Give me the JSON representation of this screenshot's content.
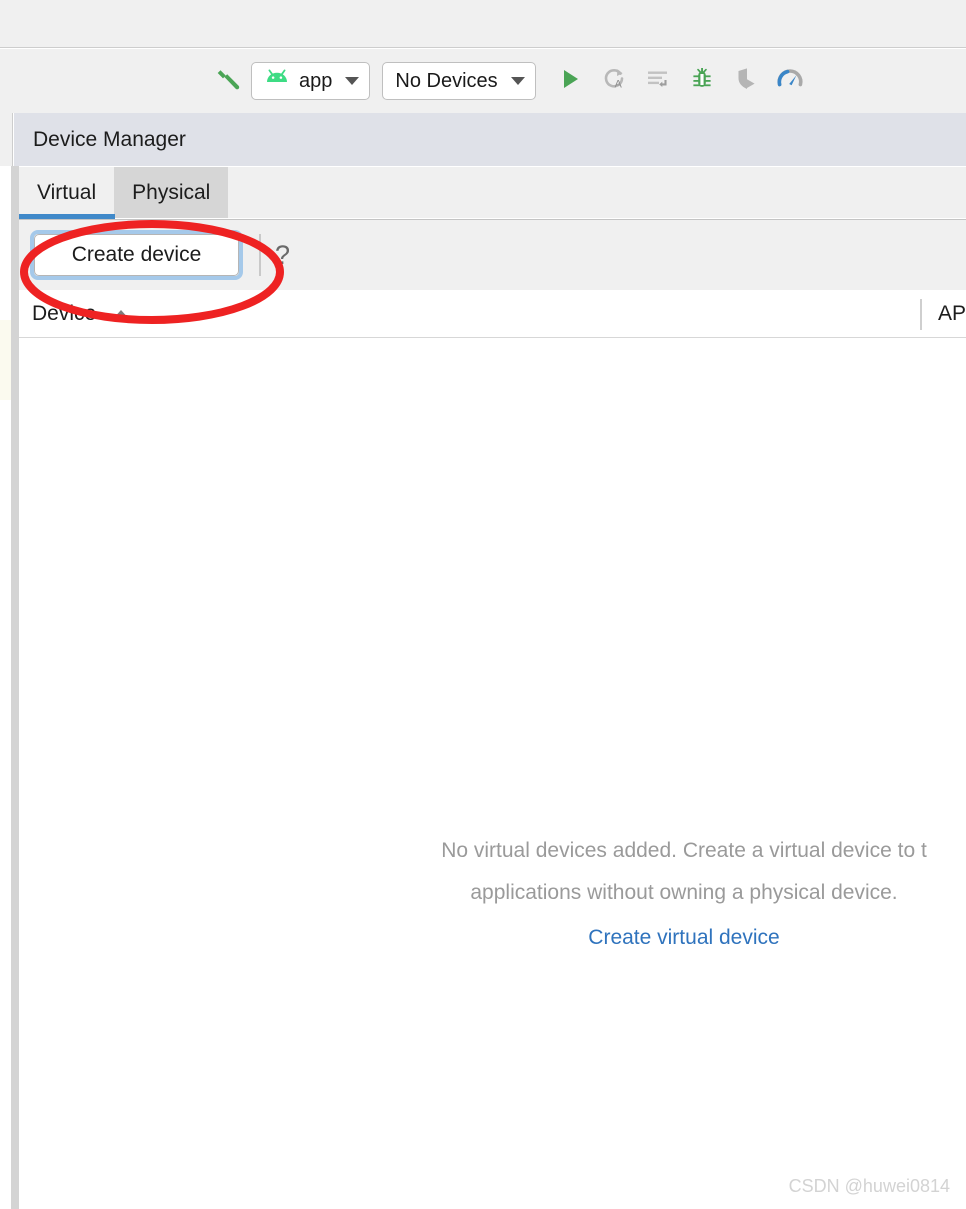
{
  "toolbar": {
    "build_icon": "hammer-icon",
    "run_config": {
      "label": "app",
      "icon": "android-head-icon"
    },
    "device_selector": {
      "label": "No Devices"
    },
    "actions": [
      {
        "name": "run-button",
        "icon": "play-icon"
      },
      {
        "name": "apply-changes-and-restart-activity-button",
        "icon": "apply-changes-restart-icon"
      },
      {
        "name": "apply-code-changes-button",
        "icon": "apply-code-changes-icon"
      },
      {
        "name": "debug-button",
        "icon": "bug-icon"
      },
      {
        "name": "run-with-profiler-button",
        "icon": "profiler-shield-icon"
      },
      {
        "name": "profiler-button",
        "icon": "profiler-gauge-icon"
      }
    ]
  },
  "tool_window": {
    "title": "Device Manager",
    "tabs": [
      {
        "label": "Virtual",
        "selected": true
      },
      {
        "label": "Physical",
        "selected": false
      }
    ],
    "action_bar": {
      "create_device_label": "Create device",
      "help_icon": "question-mark-icon",
      "help_glyph": "?"
    },
    "table": {
      "columns": [
        {
          "label": "Device",
          "sort": "ascending"
        },
        {
          "label": "AP"
        }
      ],
      "rows": []
    },
    "empty_state": {
      "line1": "No virtual devices added. Create a virtual device to t",
      "line2": "applications without owning a physical device.",
      "link": "Create virtual device"
    }
  },
  "annotation": {
    "type": "ellipse",
    "color": "#ee2222",
    "target": "create-device-button"
  },
  "watermark": "CSDN @huwei0814",
  "colors": {
    "toolbar_bg": "#f0f0f0",
    "tool_window_header_bg": "#dfe1e8",
    "tab_selected_underline": "#4089c9",
    "tab_hover_bg": "#d6d6d6",
    "focus_ring": "#a5c9ea",
    "link": "#2f73bd",
    "empty_text": "#9a9a9a",
    "accent_green": "#48a14b",
    "annotation_red": "#ee2222"
  }
}
